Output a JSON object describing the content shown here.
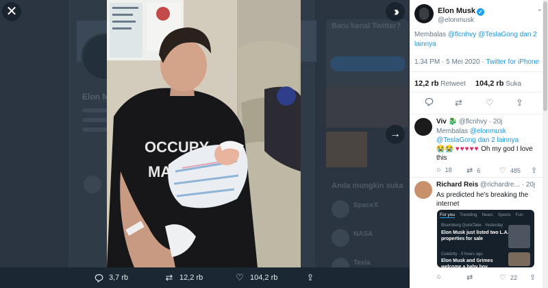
{
  "background": {
    "profile_name": "Elon M",
    "sidebar_title": "Baru kenal Twitter?",
    "suggest_title": "Anda mungkin suka",
    "suggestions": [
      "SpaceX",
      "NASA",
      "Tesla"
    ]
  },
  "lightbox": {
    "close_icon": "close-icon",
    "expand_icon": "expand-icon",
    "next_icon": "next-arrow-icon",
    "photo_shirt_text": [
      "OCCUPY",
      "MARS"
    ]
  },
  "photo_bar": {
    "replies": "3,7 rb",
    "retweets": "12,2 rb",
    "likes": "104,2 rb"
  },
  "tweet": {
    "author_name": "Elon Musk",
    "author_handle": "@elonmusk",
    "reply_prefix": "Membalas ",
    "reply_mentions": "@flcnhvy @TeslaGong",
    "reply_suffix": " dan 2 lainnya",
    "time": "1.34 PM · 5 Mei 2020 · ",
    "source": "Twitter for iPhone",
    "retweet_count": "12,2 rb",
    "retweet_label": " Retweet",
    "like_count": "104,2 rb",
    "like_label": " Suka"
  },
  "replies": [
    {
      "name": "Viv",
      "badge": "🐉",
      "handle": "@flcnhvy · 20j",
      "reply_prefix": "Membalas ",
      "reply_mentions": "@elonmusk @TeslaGong",
      "reply_suffix": " dan 2 lainnya",
      "emoji": "😭😭",
      "hearts": "♥♥♥♥♥",
      "text": " Oh my god I love this",
      "reply_count": "18",
      "retweet_count": "6",
      "like_count": "485"
    },
    {
      "name": "Richard Reis",
      "handle": "@richardre... · 20j",
      "text": "As predicted he's breaking the internet",
      "card": {
        "tabs": [
          "For you",
          "Trending",
          "News",
          "Sports",
          "Fun"
        ],
        "source1": "Bloomberg QuickTake · Yesterday",
        "headline1": "Elon Musk just listed two L.A. properties for sale",
        "source2": "Celebrity · 5 hours ago",
        "headline2": "Elon Musk and Grimes welcome a baby boy"
      },
      "like_count": "22"
    }
  ],
  "colors": {
    "accent": "#1da1f2",
    "link": "#1b95e0",
    "heart": "#e0245e",
    "overlay": "#1b2733"
  }
}
